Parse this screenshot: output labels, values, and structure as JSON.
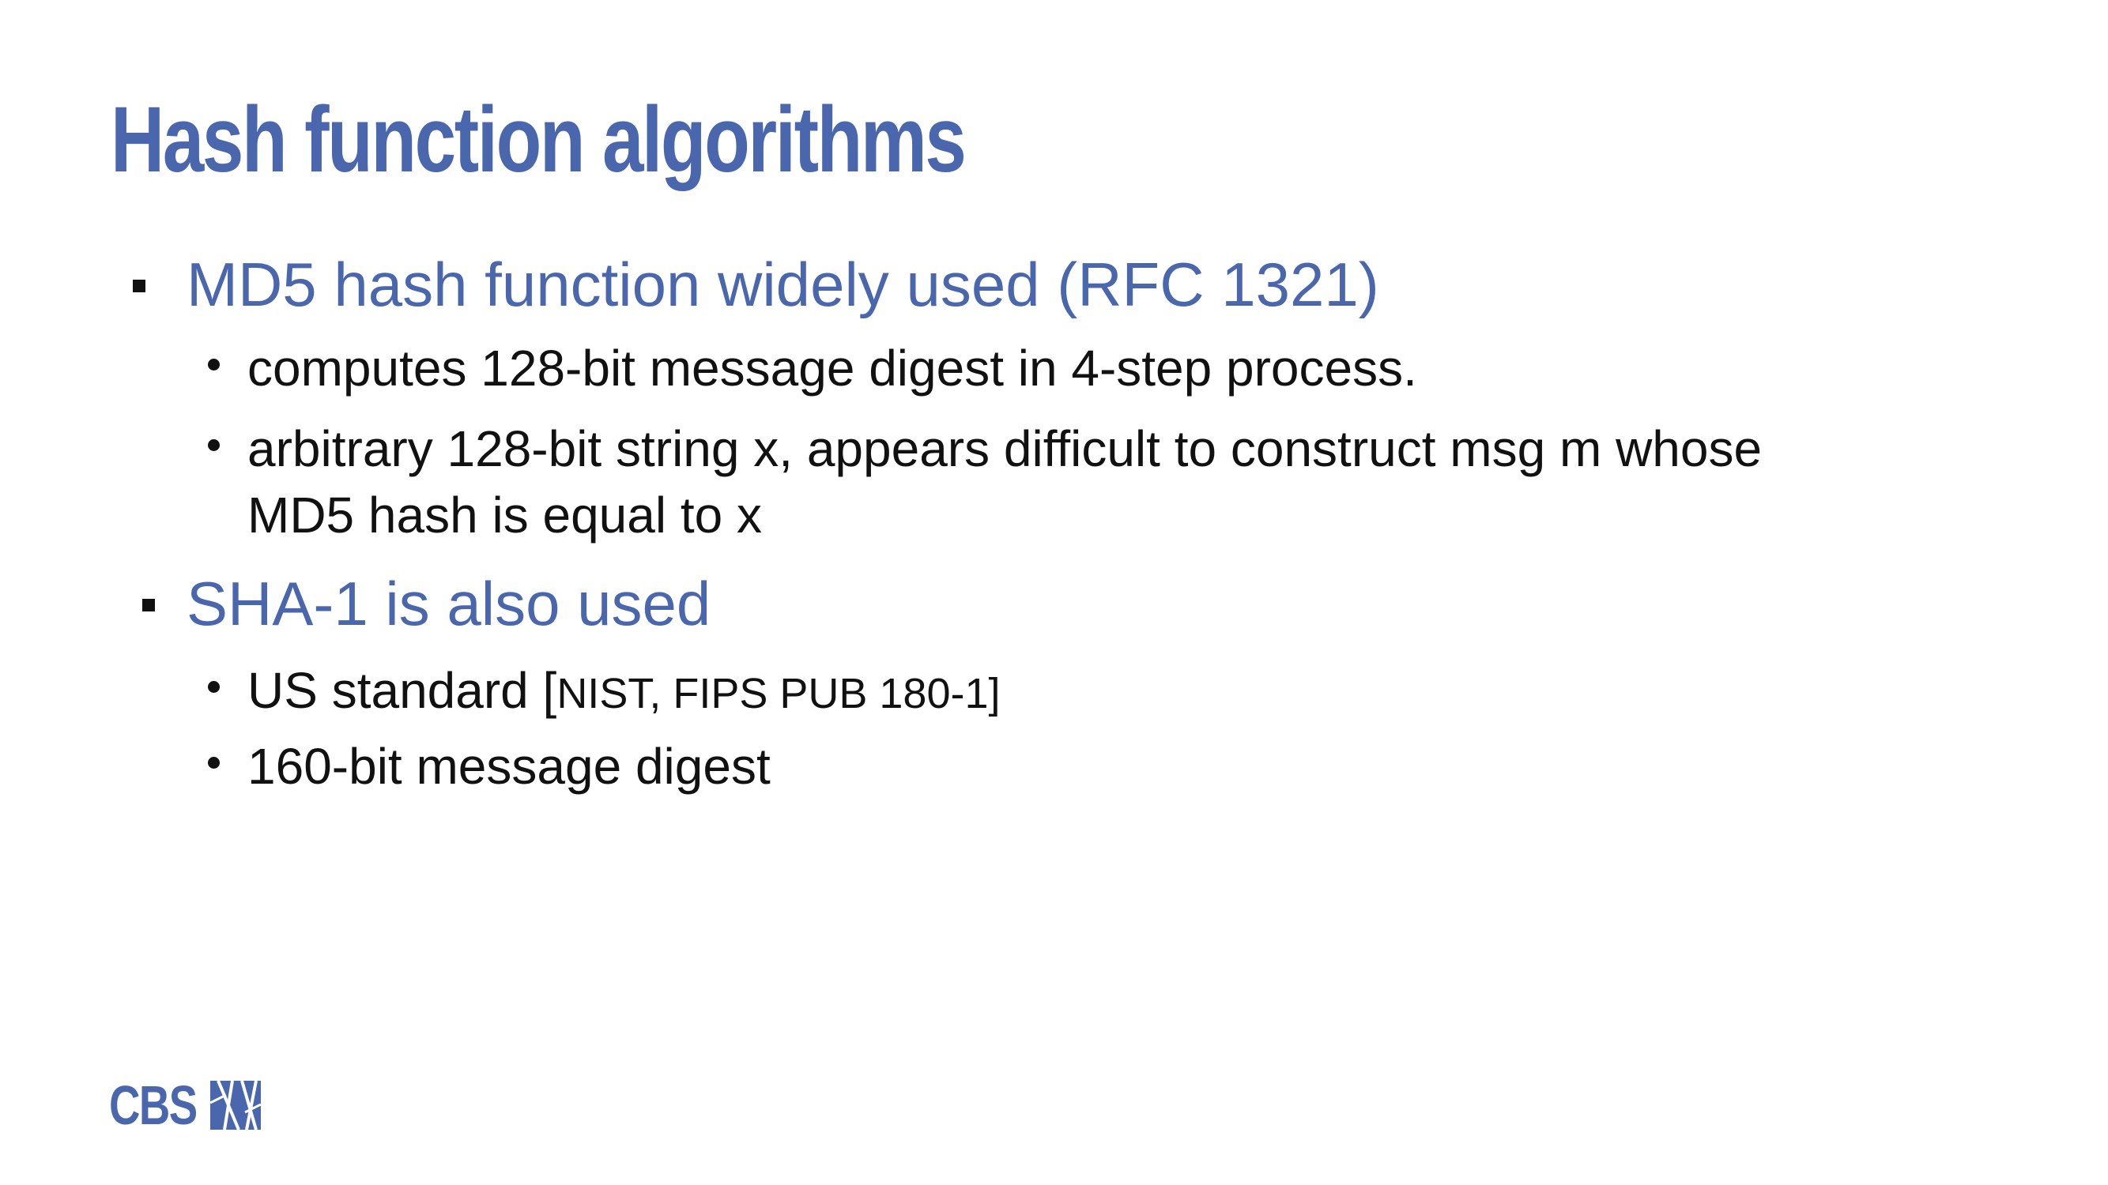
{
  "slide": {
    "title": "Hash function algorithms",
    "items": [
      {
        "text": "MD5 hash function widely used (RFC 1321)",
        "subitems": [
          {
            "text": "computes 128-bit message digest in 4-step process."
          },
          {
            "line1": "arbitrary 128-bit string x, appears difficult to construct msg m whose",
            "line2": "MD5 hash is equal to x"
          }
        ]
      },
      {
        "text": "SHA-1 is also used",
        "subitems": [
          {
            "main": "US standard [",
            "small": "NIST, FIPS PUB 180-1]"
          },
          {
            "text": "160-bit message digest"
          }
        ]
      }
    ]
  },
  "logo": {
    "text": "CBS"
  },
  "colors": {
    "accent": "#4a66ad",
    "text": "#111111",
    "background": "#ffffff"
  }
}
